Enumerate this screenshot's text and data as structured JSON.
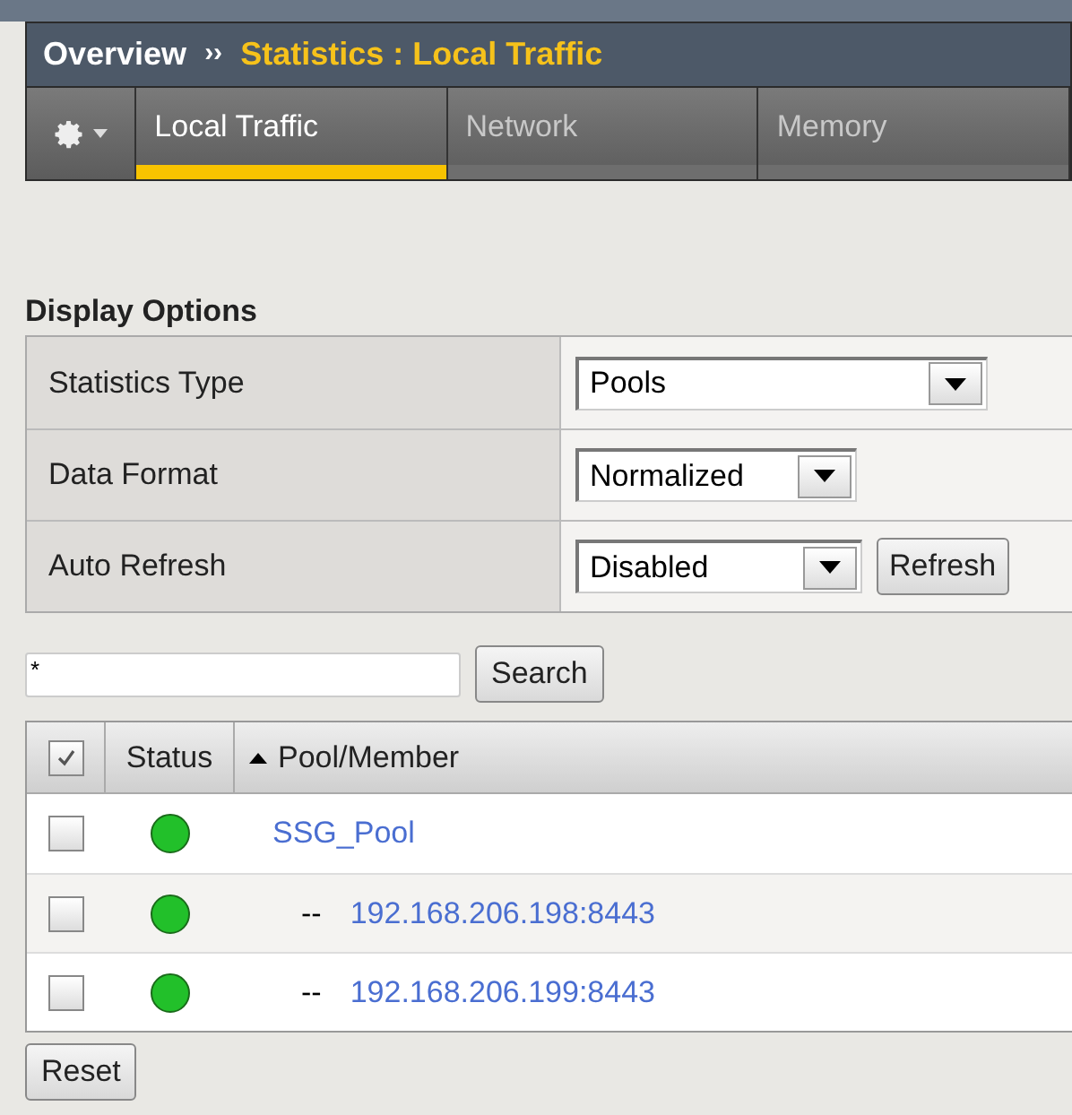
{
  "breadcrumb": {
    "root": "Overview",
    "separator": "››",
    "current": "Statistics : Local Traffic"
  },
  "tabs": [
    {
      "label": "Local Traffic",
      "selected": true
    },
    {
      "label": "Network",
      "selected": false
    },
    {
      "label": "Memory",
      "selected": false
    }
  ],
  "display_options": {
    "title": "Display Options",
    "rows": [
      {
        "label": "Statistics Type",
        "select": "Pools"
      },
      {
        "label": "Data Format",
        "select": "Normalized"
      },
      {
        "label": "Auto Refresh",
        "select": "Disabled",
        "button": "Refresh"
      }
    ]
  },
  "search": {
    "value": "*",
    "button": "Search"
  },
  "table": {
    "select_all_checked": true,
    "columns": [
      "Status",
      "Pool/Member"
    ],
    "rows": [
      {
        "name": "SSG_Pool",
        "checked": false,
        "color": "#22c02a",
        "children": [
          {
            "prefix": "--",
            "name": "192.168.206.198:8443",
            "checked": false,
            "color": "#22c02a"
          },
          {
            "prefix": "--",
            "name": "192.168.206.199:8443",
            "checked": false,
            "color": "#22c02a"
          }
        ]
      }
    ]
  },
  "reset_button": "Reset"
}
